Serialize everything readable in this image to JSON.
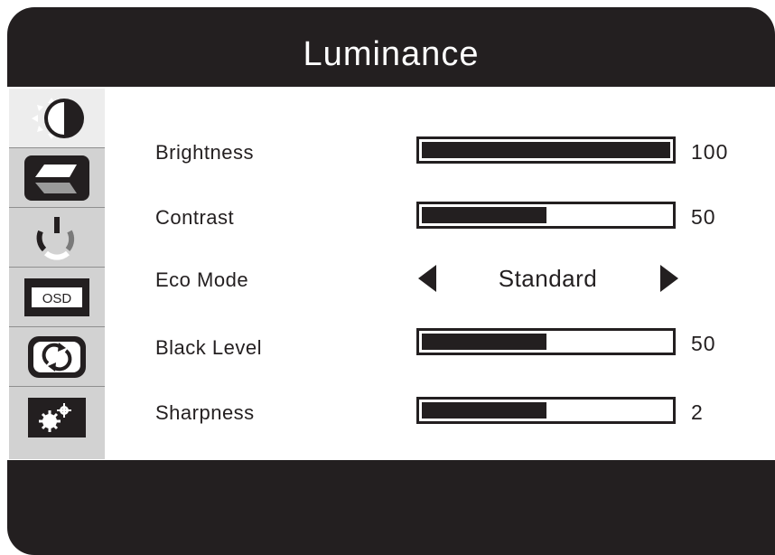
{
  "menu": {
    "title": "Luminance",
    "tabs": [
      {
        "icon": "luminance-icon",
        "selected": true
      },
      {
        "icon": "image-setup-icon",
        "selected": false
      },
      {
        "icon": "color-temperature-icon",
        "selected": false
      },
      {
        "icon": "osd-setup-icon",
        "selected": false
      },
      {
        "icon": "reset-icon",
        "selected": false
      },
      {
        "icon": "misc-settings-icon",
        "selected": false
      }
    ],
    "items": [
      {
        "label": "Brightness",
        "value": "100",
        "level": 100,
        "max": 100
      },
      {
        "label": "Contrast",
        "value": "50",
        "level": 50,
        "max": 100
      },
      {
        "label": "Eco Mode",
        "value": "Standard",
        "left_icon": "arrow-left-icon",
        "right_icon": "arrow-right-icon"
      },
      {
        "label": "Black Level",
        "value": "50",
        "level": 50,
        "max": 100
      },
      {
        "label": "Sharpness",
        "value": "2",
        "level": 2,
        "max": 4
      }
    ]
  },
  "colors": {
    "frame": "#231f20",
    "sidebar": "#d2d2d2",
    "selected_tab": "#ededed",
    "content_bg": "#ffffff"
  }
}
